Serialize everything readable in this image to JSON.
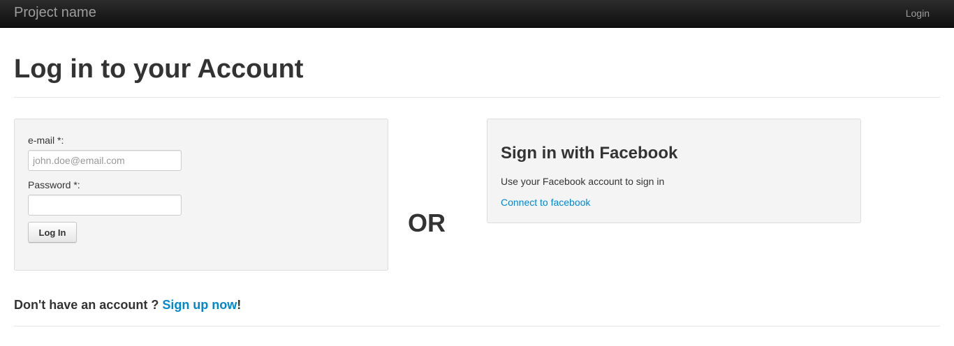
{
  "navbar": {
    "brand": "Project name",
    "login_link": "Login"
  },
  "page": {
    "title": "Log in to your Account"
  },
  "login_form": {
    "email_label": "e-mail *:",
    "email_placeholder": "john.doe@email.com",
    "email_value": "",
    "password_label": "Password *:",
    "password_value": "",
    "submit_label": "Log In"
  },
  "separator": {
    "text": "OR"
  },
  "facebook": {
    "title": "Sign in with Facebook",
    "description": "Use your Facebook account to sign in",
    "connect_link": "Connect to facebook"
  },
  "signup": {
    "prompt": "Don't have an account ? ",
    "link": "Sign up now",
    "suffix": "!"
  },
  "colors": {
    "link": "#0088cc",
    "navbar": "#1b1b1b",
    "well_background": "#f4f4f4"
  }
}
